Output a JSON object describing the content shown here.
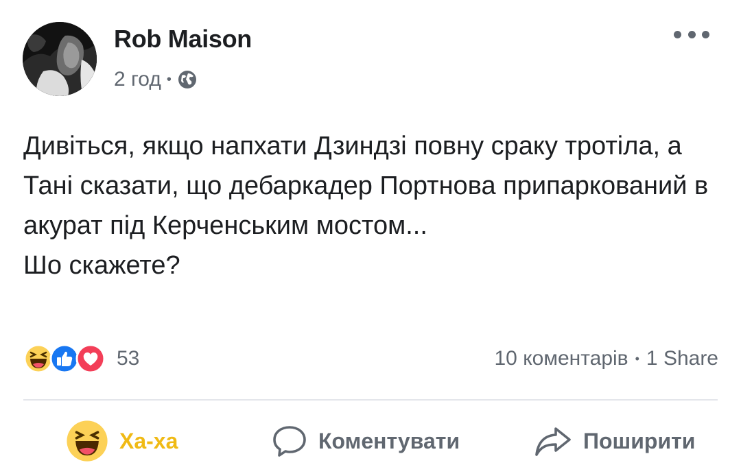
{
  "post": {
    "author": "Rob Maison",
    "time": "2 год",
    "separator": "•",
    "privacy_icon": "globe-icon",
    "more_icon": "more-horizontal-icon",
    "text_lines": [
      "Дивіться, якщо напхати Дзиндзі повну сраку тротіла, а Тані сказати, що дебаркадер Портнова припаркований в акурат під Керченським мостом...",
      "Шо скажете?"
    ]
  },
  "reactions": {
    "icons": [
      "haha-icon",
      "like-icon",
      "love-icon"
    ],
    "count": "53"
  },
  "stats": {
    "comments": "10 коментарів",
    "separator": "•",
    "shares": "1 Share"
  },
  "actions": {
    "haha_label": "Ха-ха",
    "comment_label": "Коментувати",
    "share_label": "Поширити"
  },
  "colors": {
    "haha_active": "#f0ba15",
    "like_blue": "#1877f2",
    "love_red": "#f33e58",
    "secondary_text": "#606770"
  }
}
